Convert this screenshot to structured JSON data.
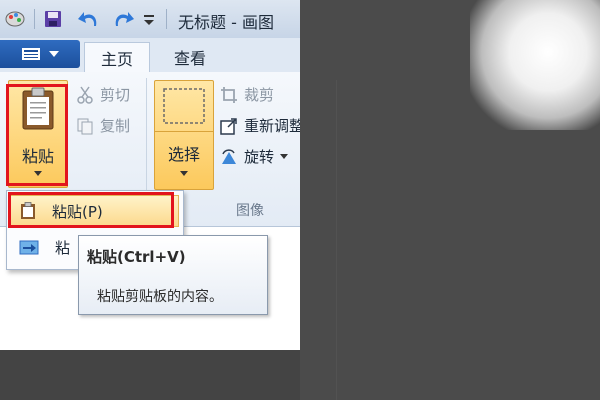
{
  "window": {
    "title": "无标题 - 画图"
  },
  "quick_access": {
    "items": [
      "app-icon",
      "save-icon",
      "undo-icon",
      "redo-icon",
      "customize-dropdown-icon"
    ]
  },
  "tabs": [
    {
      "label": "主页",
      "active": true
    },
    {
      "label": "查看",
      "active": false
    }
  ],
  "ribbon": {
    "clipboard": {
      "paste_label": "粘贴",
      "cut_label": "剪切",
      "copy_label": "复制"
    },
    "image": {
      "select_label": "选择",
      "crop_label": "裁剪",
      "resize_label": "重新调整",
      "rotate_label": "旋转",
      "group_label": "图像"
    }
  },
  "paste_menu": {
    "items": [
      {
        "label": "粘贴(P)",
        "highlighted": true
      },
      {
        "label": "粘",
        "highlighted": false
      }
    ]
  },
  "tooltip": {
    "title": "粘贴(Ctrl+V)",
    "description": "粘贴剪贴板的内容。"
  },
  "colors": {
    "highlight_border": "#e2141d",
    "button_hover": "#fcc95c",
    "file_tab": "#1c4f9c"
  }
}
